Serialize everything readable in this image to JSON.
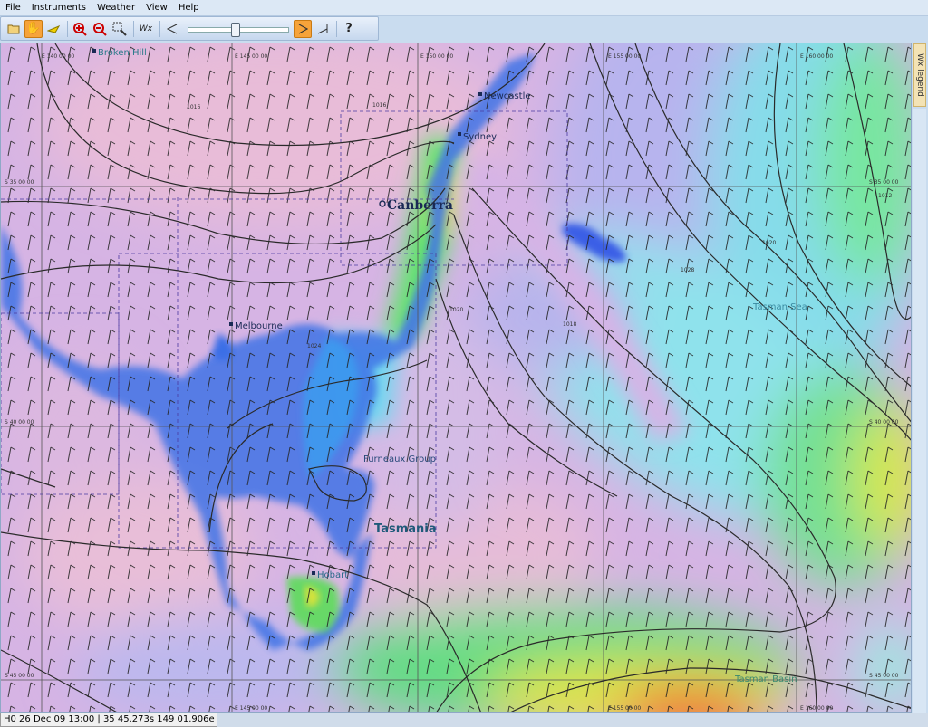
{
  "menu": {
    "items": [
      "File",
      "Instruments",
      "Weather",
      "View",
      "Help"
    ]
  },
  "toolbar": {
    "wx_label": "Wx",
    "help_label": "?"
  },
  "map": {
    "places": {
      "broken_hill": "Broken Hill",
      "newcastle": "Newcastle",
      "sydney": "Sydney",
      "canberra": "Canberra",
      "melbourne": "Melbourne",
      "furneaux": "Furneaux Group",
      "tasmania": "Tasmania",
      "hobart": "Hobart",
      "tasman_sea": "Tasman Sea",
      "tasman_basin": "Tasman Basin"
    },
    "lon_labels": {
      "l140": "E 140 00 00",
      "l145": "E 145 00 00",
      "l150": "E 150 00 00",
      "l155": "E 155 00 00",
      "l160": "E 160 00 00",
      "b145": "E 145 00 00",
      "b155": "E 155 00 00",
      "b160": "E 160 00 00"
    },
    "lat_labels": {
      "s35": "S 35 00 00",
      "s40": "S 40 00 00",
      "s45": "S 45 00 00",
      "s35r": "S 35 00 00",
      "s40r": "S 40 00 00",
      "s45r": "S 45 00 00"
    },
    "isobar_labels": {
      "i1016": "1016",
      "i1016b": "1016",
      "i1020": "1020",
      "i1020b": "1020",
      "i1018": "1018",
      "i1028": "1028",
      "i1012": "1012",
      "i1024": "1024"
    }
  },
  "legend_tab": "Wx legend",
  "status": {
    "text": "H0 26 Dec 09 13:00 | 35 45.273s  149 01.906e"
  },
  "colors": {
    "calm": "#e6b8d8",
    "light": "#b8b0ec",
    "moderate": "#7fe0ee",
    "fresh": "#59e07a",
    "strong": "#e8e23a",
    "gale": "#f04020",
    "land_shallow": "#2f6fe0",
    "accent_active": "#f6a33a"
  }
}
